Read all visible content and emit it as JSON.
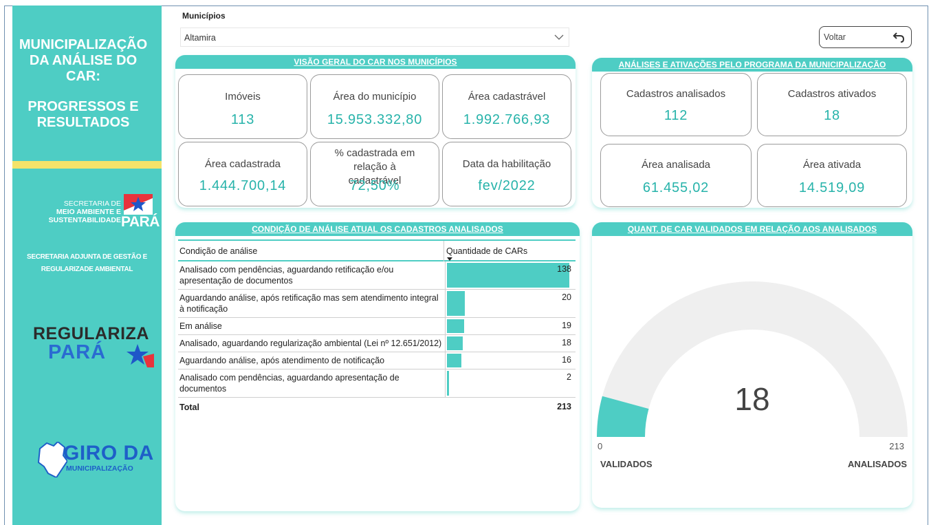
{
  "sidebar": {
    "title_lines": [
      "MUNICIPALIZAÇÃO",
      "DA ANÁLISE DO",
      "CAR:",
      "PROGRESSOS E",
      "RESULTADOS"
    ],
    "semas": {
      "line1": "SECRETARIA DE",
      "line2": "MEIO AMBIENTE E",
      "line3": "SUSTENTABILIDADE",
      "para": "PARÁ"
    },
    "secretaria_adjunta": [
      "SECRETARIA ADJUNTA DE GESTÃO E",
      "REGULARIZADE AMBIENTAL"
    ],
    "regulariza": {
      "line1": "REGULARIZA",
      "line2": "PARÁ"
    },
    "giro": {
      "line1": "GIRO DA",
      "line2": "MUNICIPALIZAÇÃO"
    }
  },
  "filter": {
    "label": "Municípios",
    "value": "Altamira"
  },
  "voltar_label": "Voltar",
  "visao_geral": {
    "title": "VISÃO GERAL DO CAR NOS MUNICÍPIOS",
    "cards": [
      {
        "label": "Imóveis",
        "value": "113"
      },
      {
        "label": "Área do município",
        "value": "15.953.332,80"
      },
      {
        "label": "Área cadastrável",
        "value": "1.992.766,93"
      },
      {
        "label": "Área cadastrada",
        "value": "1.444.700,14"
      },
      {
        "label": "% cadastrada em relação à cadastrável",
        "value": "72,50%"
      },
      {
        "label": "Data da habilitação",
        "value": "fev/2022"
      }
    ]
  },
  "analises": {
    "title": "ANÁLISES E ATIVAÇÕES PELO PROGRAMA DA MUNICIPALIZAÇÃO",
    "cards": [
      {
        "label": "Cadastros analisados",
        "value": "112"
      },
      {
        "label": "Cadastros ativados",
        "value": "18"
      },
      {
        "label": "Área analisada",
        "value": "61.455,02"
      },
      {
        "label": "Área ativada",
        "value": "14.519,09"
      }
    ]
  },
  "condicao": {
    "title": "CONDIÇÃO DE ANÁLISE ATUAL  OS CADASTROS ANALISADOS",
    "col1": "Condição de análise",
    "col2": "Quantidade de CARs",
    "rows": [
      {
        "label": "Analisado com pendências, aguardando retificação e/ou apresentação de documentos",
        "value": 138
      },
      {
        "label": "Aguardando análise, após retificação mas sem atendimento integral à notificação",
        "value": 20
      },
      {
        "label": "Em análise",
        "value": 19
      },
      {
        "label": "Analisado, aguardando regularização ambiental (Lei nº 12.651/2012)",
        "value": 18
      },
      {
        "label": "Aguardando análise, após atendimento de notificação",
        "value": 16
      },
      {
        "label": "Analisado com pendências, aguardando apresentação de documentos",
        "value": 2
      }
    ],
    "total_label": "Total",
    "total_value": "213",
    "bar_color": "#4ecdc4"
  },
  "gauge": {
    "title": "QUANT. DE CAR VALIDADOS EM RELAÇÃO AOS ANALISADOS",
    "value": 18,
    "min": 0,
    "max": 213,
    "value_label": "18",
    "min_label": "0",
    "max_label": "213",
    "left_caption": "VALIDADOS",
    "right_caption": "ANALISADOS",
    "fill_color": "#4ecdc4",
    "track_color": "#efefef"
  },
  "colors": {
    "accent": "#4ecdc4",
    "value_text": "#27b3aa",
    "sidebar_stripe": "#f4e36a"
  }
}
